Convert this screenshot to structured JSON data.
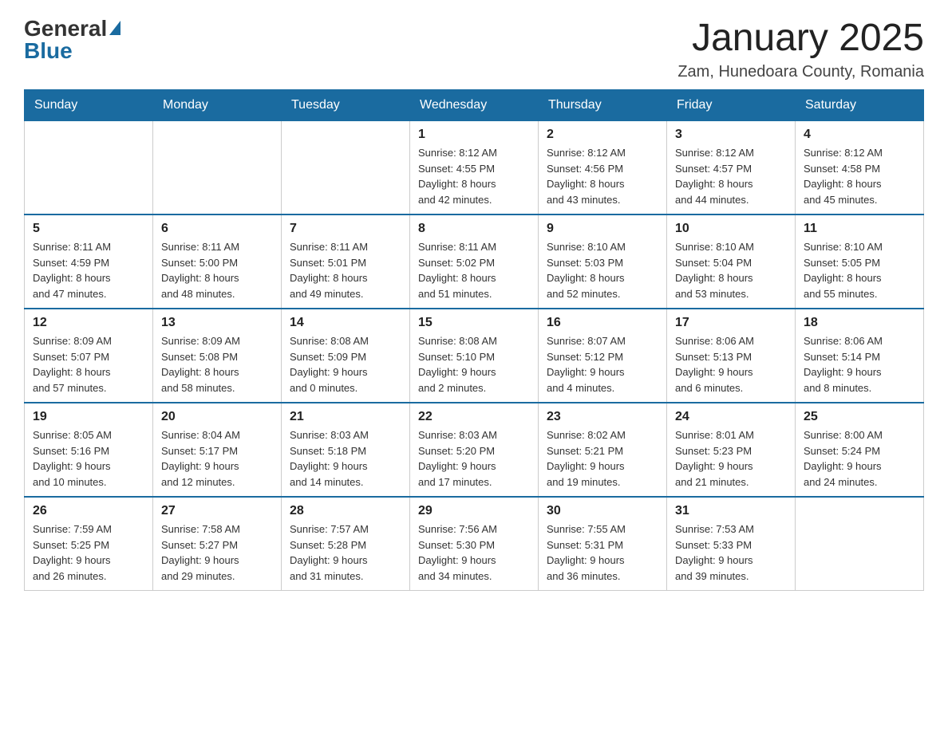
{
  "logo": {
    "general": "General",
    "blue": "Blue"
  },
  "title": "January 2025",
  "location": "Zam, Hunedoara County, Romania",
  "days_of_week": [
    "Sunday",
    "Monday",
    "Tuesday",
    "Wednesday",
    "Thursday",
    "Friday",
    "Saturday"
  ],
  "weeks": [
    [
      {
        "day": "",
        "info": ""
      },
      {
        "day": "",
        "info": ""
      },
      {
        "day": "",
        "info": ""
      },
      {
        "day": "1",
        "info": "Sunrise: 8:12 AM\nSunset: 4:55 PM\nDaylight: 8 hours\nand 42 minutes."
      },
      {
        "day": "2",
        "info": "Sunrise: 8:12 AM\nSunset: 4:56 PM\nDaylight: 8 hours\nand 43 minutes."
      },
      {
        "day": "3",
        "info": "Sunrise: 8:12 AM\nSunset: 4:57 PM\nDaylight: 8 hours\nand 44 minutes."
      },
      {
        "day": "4",
        "info": "Sunrise: 8:12 AM\nSunset: 4:58 PM\nDaylight: 8 hours\nand 45 minutes."
      }
    ],
    [
      {
        "day": "5",
        "info": "Sunrise: 8:11 AM\nSunset: 4:59 PM\nDaylight: 8 hours\nand 47 minutes."
      },
      {
        "day": "6",
        "info": "Sunrise: 8:11 AM\nSunset: 5:00 PM\nDaylight: 8 hours\nand 48 minutes."
      },
      {
        "day": "7",
        "info": "Sunrise: 8:11 AM\nSunset: 5:01 PM\nDaylight: 8 hours\nand 49 minutes."
      },
      {
        "day": "8",
        "info": "Sunrise: 8:11 AM\nSunset: 5:02 PM\nDaylight: 8 hours\nand 51 minutes."
      },
      {
        "day": "9",
        "info": "Sunrise: 8:10 AM\nSunset: 5:03 PM\nDaylight: 8 hours\nand 52 minutes."
      },
      {
        "day": "10",
        "info": "Sunrise: 8:10 AM\nSunset: 5:04 PM\nDaylight: 8 hours\nand 53 minutes."
      },
      {
        "day": "11",
        "info": "Sunrise: 8:10 AM\nSunset: 5:05 PM\nDaylight: 8 hours\nand 55 minutes."
      }
    ],
    [
      {
        "day": "12",
        "info": "Sunrise: 8:09 AM\nSunset: 5:07 PM\nDaylight: 8 hours\nand 57 minutes."
      },
      {
        "day": "13",
        "info": "Sunrise: 8:09 AM\nSunset: 5:08 PM\nDaylight: 8 hours\nand 58 minutes."
      },
      {
        "day": "14",
        "info": "Sunrise: 8:08 AM\nSunset: 5:09 PM\nDaylight: 9 hours\nand 0 minutes."
      },
      {
        "day": "15",
        "info": "Sunrise: 8:08 AM\nSunset: 5:10 PM\nDaylight: 9 hours\nand 2 minutes."
      },
      {
        "day": "16",
        "info": "Sunrise: 8:07 AM\nSunset: 5:12 PM\nDaylight: 9 hours\nand 4 minutes."
      },
      {
        "day": "17",
        "info": "Sunrise: 8:06 AM\nSunset: 5:13 PM\nDaylight: 9 hours\nand 6 minutes."
      },
      {
        "day": "18",
        "info": "Sunrise: 8:06 AM\nSunset: 5:14 PM\nDaylight: 9 hours\nand 8 minutes."
      }
    ],
    [
      {
        "day": "19",
        "info": "Sunrise: 8:05 AM\nSunset: 5:16 PM\nDaylight: 9 hours\nand 10 minutes."
      },
      {
        "day": "20",
        "info": "Sunrise: 8:04 AM\nSunset: 5:17 PM\nDaylight: 9 hours\nand 12 minutes."
      },
      {
        "day": "21",
        "info": "Sunrise: 8:03 AM\nSunset: 5:18 PM\nDaylight: 9 hours\nand 14 minutes."
      },
      {
        "day": "22",
        "info": "Sunrise: 8:03 AM\nSunset: 5:20 PM\nDaylight: 9 hours\nand 17 minutes."
      },
      {
        "day": "23",
        "info": "Sunrise: 8:02 AM\nSunset: 5:21 PM\nDaylight: 9 hours\nand 19 minutes."
      },
      {
        "day": "24",
        "info": "Sunrise: 8:01 AM\nSunset: 5:23 PM\nDaylight: 9 hours\nand 21 minutes."
      },
      {
        "day": "25",
        "info": "Sunrise: 8:00 AM\nSunset: 5:24 PM\nDaylight: 9 hours\nand 24 minutes."
      }
    ],
    [
      {
        "day": "26",
        "info": "Sunrise: 7:59 AM\nSunset: 5:25 PM\nDaylight: 9 hours\nand 26 minutes."
      },
      {
        "day": "27",
        "info": "Sunrise: 7:58 AM\nSunset: 5:27 PM\nDaylight: 9 hours\nand 29 minutes."
      },
      {
        "day": "28",
        "info": "Sunrise: 7:57 AM\nSunset: 5:28 PM\nDaylight: 9 hours\nand 31 minutes."
      },
      {
        "day": "29",
        "info": "Sunrise: 7:56 AM\nSunset: 5:30 PM\nDaylight: 9 hours\nand 34 minutes."
      },
      {
        "day": "30",
        "info": "Sunrise: 7:55 AM\nSunset: 5:31 PM\nDaylight: 9 hours\nand 36 minutes."
      },
      {
        "day": "31",
        "info": "Sunrise: 7:53 AM\nSunset: 5:33 PM\nDaylight: 9 hours\nand 39 minutes."
      },
      {
        "day": "",
        "info": ""
      }
    ]
  ]
}
